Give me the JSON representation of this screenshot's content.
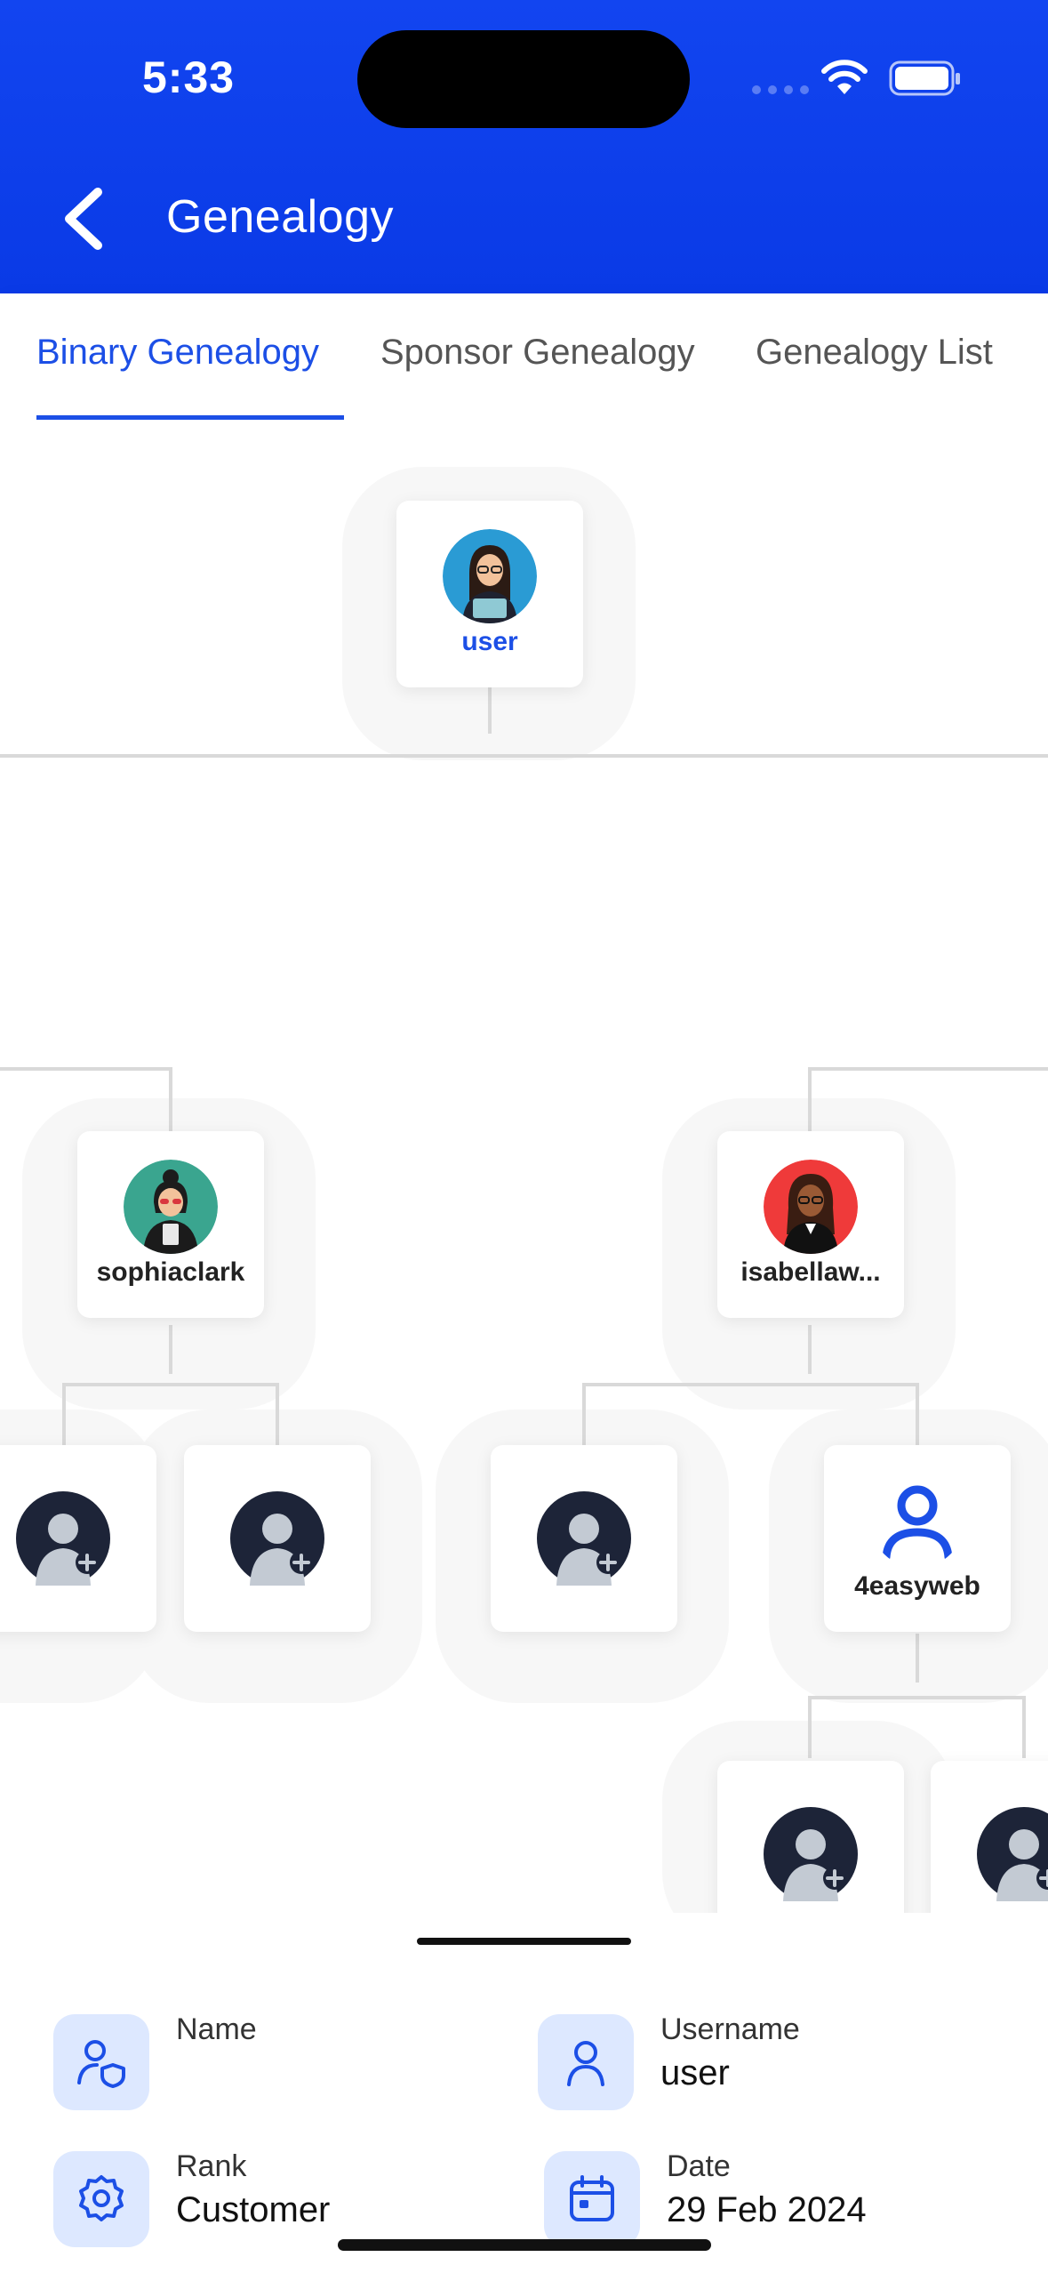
{
  "status_bar": {
    "time": "5:33"
  },
  "header": {
    "title": "Genealogy",
    "back_icon": "chevron-left-icon"
  },
  "tabs": [
    {
      "label": "Binary Genealogy",
      "active": true
    },
    {
      "label": "Sponsor Genealogy",
      "active": false
    },
    {
      "label": "Genealogy List",
      "active": false
    }
  ],
  "tree": {
    "root": {
      "name": "user"
    },
    "level1": [
      {
        "name": "sophiaclark"
      },
      {
        "name": "isabellaw..."
      }
    ],
    "level2": [
      {
        "name": "",
        "empty": true
      },
      {
        "name": "",
        "empty": true
      },
      {
        "name": "",
        "empty": true
      },
      {
        "name": "4easyweb",
        "empty": false
      }
    ],
    "level3": [
      {
        "name": "",
        "empty": true
      },
      {
        "name": "",
        "empty": true
      }
    ]
  },
  "details": {
    "name_label": "Name",
    "name_value": "",
    "username_label": "Username",
    "username_value": "user",
    "rank_label": "Rank",
    "rank_value": "Customer",
    "date_label": "Date",
    "date_value": "29 Feb 2024"
  },
  "colors": {
    "accent": "#1c4fe6",
    "header": "#0a3ae6"
  }
}
